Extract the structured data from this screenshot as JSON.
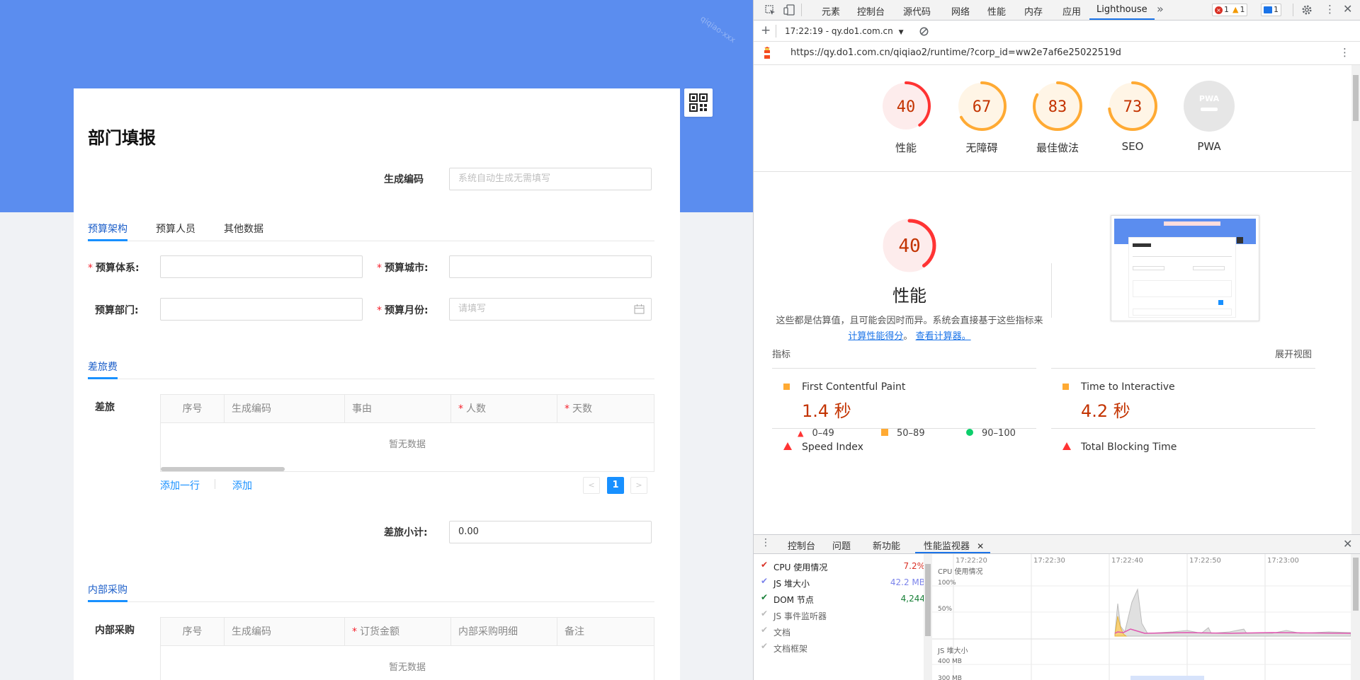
{
  "form": {
    "title": "部门填报",
    "watermark": "qiqiao-xxx",
    "code_label": "生成编码",
    "code_placeholder": "系统自动生成无需填写",
    "tabs": [
      "预算架构",
      "预算人员",
      "其他数据"
    ],
    "fields": {
      "system_label": "预算体系:",
      "city_label": "预算城市:",
      "dept_label": "预算部门:",
      "month_label": "预算月份:",
      "month_placeholder": "请填写"
    },
    "travel": {
      "section_tab": "差旅费",
      "row_label": "差旅",
      "columns": [
        "序号",
        "生成编码",
        "事由",
        "人数",
        "天数"
      ],
      "empty_text": "暂无数据",
      "add_row": "添加一行",
      "add": "添加",
      "page": "1",
      "subtotal_label": "差旅小计:",
      "subtotal_value": "0.00"
    },
    "purchase": {
      "section_tab": "内部采购",
      "row_label": "内部采购",
      "columns": [
        "序号",
        "生成编码",
        "订货金额",
        "内部采购明细",
        "备注"
      ],
      "empty_text": "暂无数据"
    }
  },
  "devtools": {
    "tabs": [
      "元素",
      "控制台",
      "源代码",
      "网络",
      "性能",
      "内存",
      "应用",
      "Lighthouse"
    ],
    "more": "»",
    "badges": {
      "errors": "1",
      "warnings": "1",
      "messages": "1"
    },
    "lighthouse_session": "17:22:19 - qy.do1.com.cn",
    "url": "https://qy.do1.com.cn/qiqiao2/runtime/?corp_id=ww2e7af6e25022519d",
    "scores": [
      {
        "value": "40",
        "label": "性能",
        "color": "#ff3333",
        "bg": "#fdecec",
        "fraction": 0.4
      },
      {
        "value": "67",
        "label": "无障碍",
        "color": "#ffaa33",
        "bg": "#fff5e6",
        "fraction": 0.67
      },
      {
        "value": "83",
        "label": "最佳做法",
        "color": "#ffaa33",
        "bg": "#fff5e6",
        "fraction": 0.83
      },
      {
        "value": "73",
        "label": "SEO",
        "color": "#ffaa33",
        "bg": "#fff5e6",
        "fraction": 0.73
      },
      {
        "value": "PWA",
        "label": "PWA",
        "color": "#bbbbbb",
        "bg": "#e6e6e6",
        "fraction": 0
      }
    ],
    "big_score": {
      "value": "40",
      "label": "性能",
      "fraction": 0.4
    },
    "note_text": "这些都是估算值，且可能会因时而异。系统会直接基于这些指标来",
    "note_link1": "计算性能得分",
    "note_sep": "。",
    "note_link2": "查看计算器。",
    "legend": [
      "0–49",
      "50–89",
      "90–100"
    ],
    "metrics_header": "指标",
    "expand_view": "展开视图",
    "metrics": [
      {
        "name": "First Contentful Paint",
        "value": "1.4 秒",
        "mark": "orange"
      },
      {
        "name": "Time to Interactive",
        "value": "4.2 秒",
        "mark": "orange"
      },
      {
        "name": "Speed Index",
        "value": "",
        "mark": "red"
      },
      {
        "name": "Total Blocking Time",
        "value": "",
        "mark": "red"
      }
    ],
    "drawer": {
      "tabs": [
        "控制台",
        "问题",
        "新功能",
        "性能监视器"
      ],
      "rows": [
        {
          "name": "CPU 使用情况",
          "value": "7.2%",
          "color": "#d93025",
          "checked": true
        },
        {
          "name": "JS 堆大小",
          "value": "42.2 MB",
          "color": "#7b83eb",
          "checked": true
        },
        {
          "name": "DOM 节点",
          "value": "4,244",
          "color": "#188038",
          "checked": true
        },
        {
          "name": "JS 事件监听器",
          "value": "",
          "color": "#999",
          "checked": false
        },
        {
          "name": "文档",
          "value": "",
          "color": "#999",
          "checked": false
        },
        {
          "name": "文档框架",
          "value": "",
          "color": "#999",
          "checked": false
        }
      ],
      "timeline": [
        "17:22:20",
        "17:22:30",
        "17:22:40",
        "17:22:50",
        "17:23:00"
      ],
      "chart_labels": {
        "cpu": "CPU 使用情况",
        "p100": "100%",
        "p50": "50%",
        "heap": "JS 堆大小",
        "m400": "400 MB",
        "m300": "300 MB"
      }
    }
  }
}
